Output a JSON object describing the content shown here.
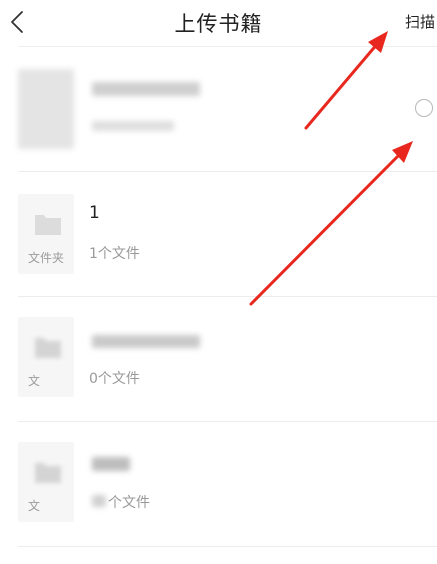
{
  "header": {
    "title": "上传书籍",
    "scan_label": "扫描",
    "back_icon": "chevron-left-icon"
  },
  "items": [
    {
      "name": "",
      "meta": "",
      "thumb_label": "",
      "type": "book",
      "blurred": true
    },
    {
      "name": "1",
      "meta": "1个文件",
      "thumb_label": "文件夹",
      "type": "folder",
      "blurred": false
    },
    {
      "name": "",
      "meta": "0个文件",
      "thumb_label": "文",
      "type": "folder",
      "blurred": true
    },
    {
      "name": "",
      "meta": "个文件",
      "thumb_label": "文",
      "type": "folder",
      "blurred": true
    }
  ],
  "annotations": {
    "arrow_color": "#e8281e"
  }
}
